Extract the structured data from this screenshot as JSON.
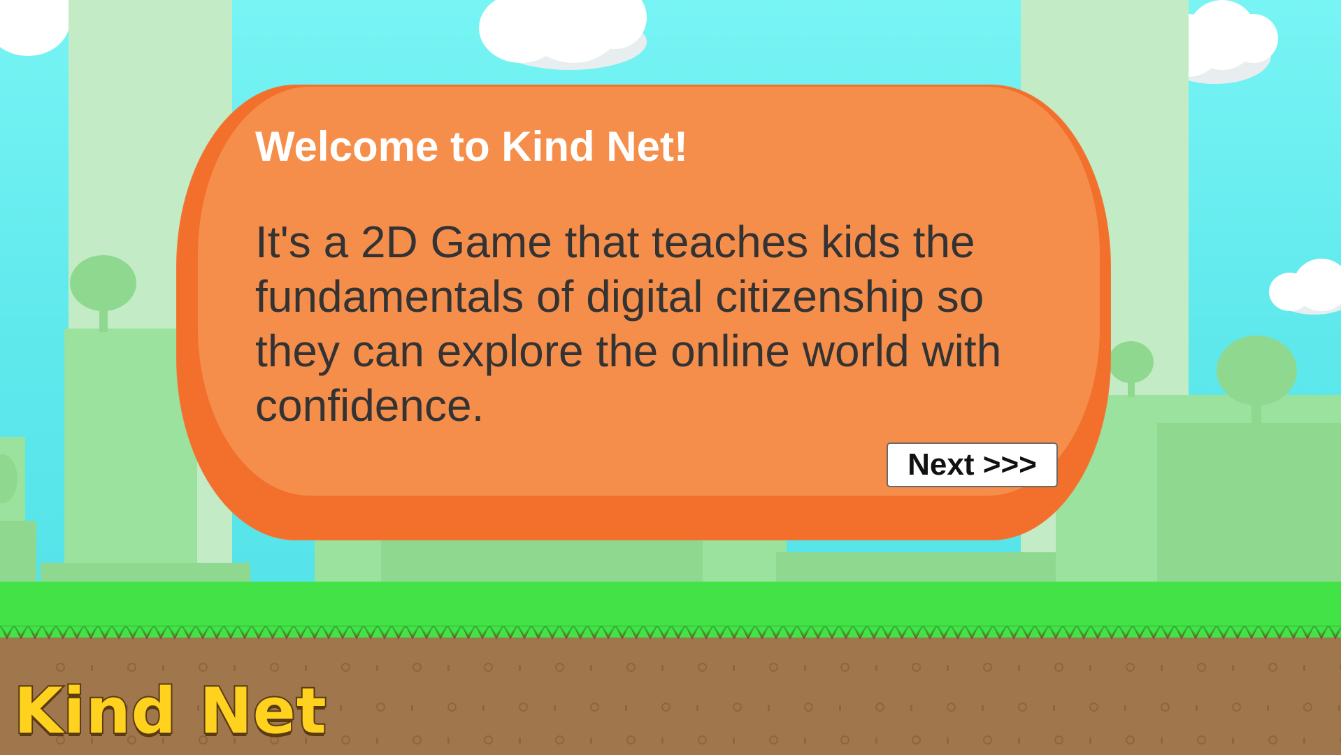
{
  "game": {
    "logo_text": "Kind Net"
  },
  "dialog": {
    "title": "Welcome to Kind Net!",
    "body": "It's a 2D Game that teaches kids the fundamentals of digital citizenship so they can explore the online world with confidence.",
    "next_label": "Next >>>"
  },
  "colors": {
    "sky": "#5ee8ec",
    "grass": "#43e246",
    "dirt": "#a0764d",
    "dialog": "#f68e4b",
    "dialog_border": "#f26f2c",
    "logo": "#ffd21f"
  }
}
